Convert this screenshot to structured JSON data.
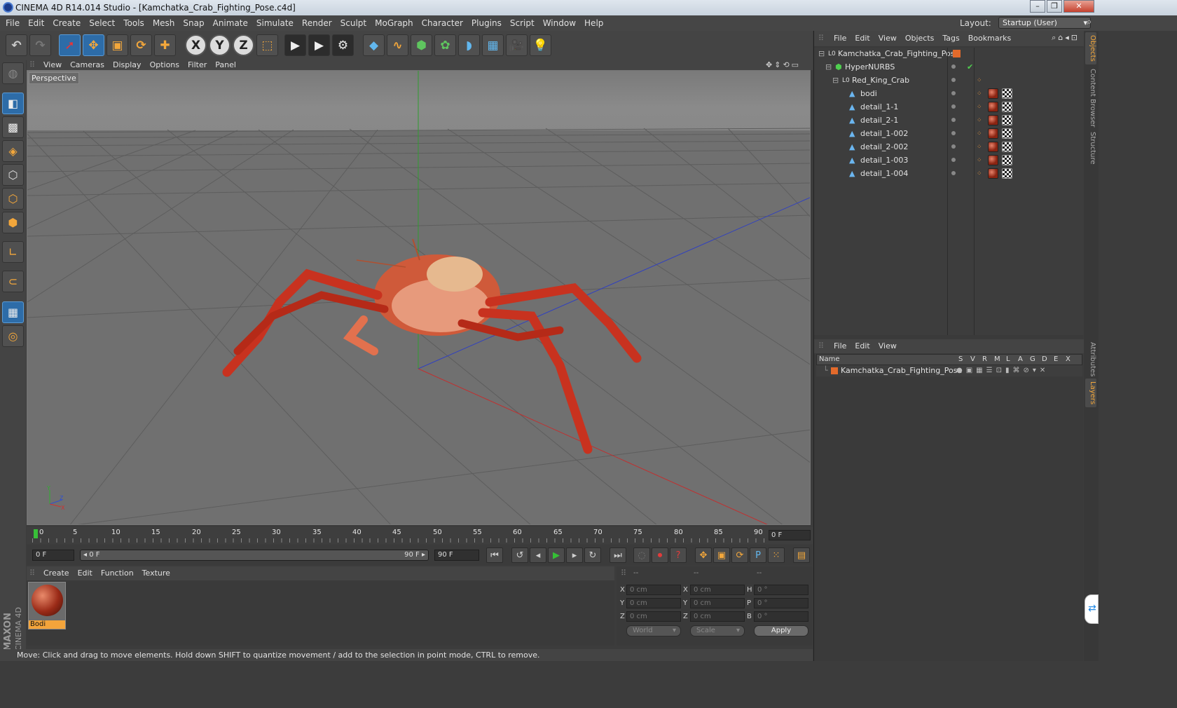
{
  "window": {
    "title": "CINEMA 4D R14.014 Studio - [Kamchatka_Crab_Fighting_Pose.c4d]"
  },
  "menubar": {
    "items": [
      "File",
      "Edit",
      "Create",
      "Select",
      "Tools",
      "Mesh",
      "Snap",
      "Animate",
      "Simulate",
      "Render",
      "Sculpt",
      "MoGraph",
      "Character",
      "Plugins",
      "Script",
      "Window",
      "Help"
    ]
  },
  "layout": {
    "label": "Layout:",
    "value": "Startup (User)"
  },
  "toolbar": {
    "icons": [
      "undo-icon",
      "redo-icon",
      "live-selection-icon",
      "move-icon",
      "scale-icon",
      "rotate-icon",
      "add-object-icon",
      "x-axis-icon",
      "y-axis-icon",
      "z-axis-icon",
      "coordinate-system-icon",
      "render-view-icon",
      "render-picture-viewer-icon",
      "render-settings-icon",
      "cube-icon",
      "spline-icon",
      "nurbs-icon",
      "array-icon",
      "deformer-icon",
      "floor-icon",
      "camera-icon",
      "light-icon"
    ]
  },
  "viewport": {
    "menu": [
      "View",
      "Cameras",
      "Display",
      "Options",
      "Filter",
      "Panel"
    ],
    "label": "Perspective",
    "axis": {
      "x": "X",
      "y": "Y",
      "z": "Z"
    }
  },
  "timeline": {
    "ticks": [
      "0",
      "5",
      "10",
      "15",
      "20",
      "25",
      "30",
      "35",
      "40",
      "45",
      "50",
      "55",
      "60",
      "65",
      "70",
      "75",
      "80",
      "85",
      "90"
    ],
    "current_frame": "0 F",
    "start_field": "0 F",
    "range_start": "0 F",
    "range_end": "90 F",
    "end_field": "90 F"
  },
  "material_manager": {
    "menu": [
      "Create",
      "Edit",
      "Function",
      "Texture"
    ],
    "materials": [
      {
        "name": "Bodi"
      }
    ]
  },
  "coordinates": {
    "headers": [
      "--",
      "--",
      "--"
    ],
    "rows": [
      {
        "axis": "X",
        "pos": "0 cm",
        "axis2": "X",
        "size": "0 cm",
        "rot_label": "H",
        "rot": "0 °"
      },
      {
        "axis": "Y",
        "pos": "0 cm",
        "axis2": "Y",
        "size": "0 cm",
        "rot_label": "P",
        "rot": "0 °"
      },
      {
        "axis": "Z",
        "pos": "0 cm",
        "axis2": "Z",
        "size": "0 cm",
        "rot_label": "B",
        "rot": "0 °"
      }
    ],
    "space": "World",
    "mode": "Scale",
    "apply": "Apply"
  },
  "status": {
    "text": "Move: Click and drag to move elements. Hold down SHIFT to quantize movement / add to the selection in point mode, CTRL to remove."
  },
  "object_manager": {
    "menu": [
      "File",
      "Edit",
      "View",
      "Objects",
      "Tags",
      "Bookmarks"
    ],
    "objects": [
      {
        "name": "Kamchatka_Crab_Fighting_Pose",
        "type": "null"
      },
      {
        "name": "HyperNURBS",
        "type": "hypernurbs"
      },
      {
        "name": "Red_King_Crab",
        "type": "null"
      },
      {
        "name": "bodi",
        "type": "polygon"
      },
      {
        "name": "detail_1-1",
        "type": "polygon"
      },
      {
        "name": "detail_2-1",
        "type": "polygon"
      },
      {
        "name": "detail_1-002",
        "type": "polygon"
      },
      {
        "name": "detail_2-002",
        "type": "polygon"
      },
      {
        "name": "detail_1-003",
        "type": "polygon"
      },
      {
        "name": "detail_1-004",
        "type": "polygon"
      }
    ]
  },
  "layer_manager": {
    "menu": [
      "File",
      "Edit",
      "View"
    ],
    "columns": [
      "Name",
      "S",
      "V",
      "R",
      "M",
      "L",
      "A",
      "G",
      "D",
      "E",
      "X"
    ],
    "layers": [
      {
        "name": "Kamchatka_Crab_Fighting_Pose"
      }
    ]
  },
  "side_tabs": [
    "Objects",
    "Content Browser",
    "Structure",
    "Attributes",
    "Layers"
  ],
  "brand": {
    "line1": "MAXON",
    "line2": "CINEMA 4D"
  }
}
